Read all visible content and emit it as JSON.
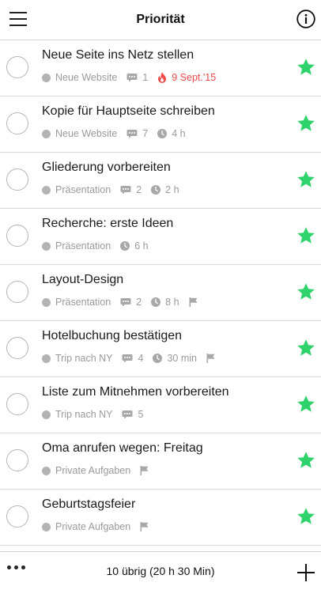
{
  "header": {
    "title": "Priorität",
    "menu_icon": "hamburger-menu-icon",
    "info_icon": "info-circle-icon"
  },
  "colors": {
    "star": "#2fd36b",
    "overdue": "#f04a4a",
    "meta": "#9a9a9a"
  },
  "tasks": [
    {
      "title": "Neue Seite ins Netz stellen",
      "project": "Neue Website",
      "comments": "1",
      "due": "9 Sept.'15",
      "overdue": true
    },
    {
      "title": "Kopie für Hauptseite schreiben",
      "project": "Neue Website",
      "comments": "7",
      "duration": "4 h"
    },
    {
      "title": "Gliederung vorbereiten",
      "project": "Präsentation",
      "comments": "2",
      "duration": "2 h"
    },
    {
      "title": "Recherche: erste Ideen",
      "project": "Präsentation",
      "duration": "6 h"
    },
    {
      "title": "Layout-Design",
      "project": "Präsentation",
      "comments": "2",
      "duration": "8 h",
      "flag": true
    },
    {
      "title": "Hotelbuchung bestätigen",
      "project": "Trip nach NY",
      "comments": "4",
      "duration": "30 min",
      "flag": true
    },
    {
      "title": "Liste zum Mitnehmen vorbereiten",
      "project": "Trip nach NY",
      "comments": "5"
    },
    {
      "title": "Oma anrufen wegen: Freitag",
      "project": "Private Aufgaben",
      "flag": true
    },
    {
      "title": "Geburtstagsfeier",
      "project": "Private Aufgaben",
      "flag": true
    }
  ],
  "footer": {
    "summary": "10 übrig (20 h 30 Min)",
    "more_icon": "more-dots-icon",
    "add_icon": "plus-icon"
  }
}
